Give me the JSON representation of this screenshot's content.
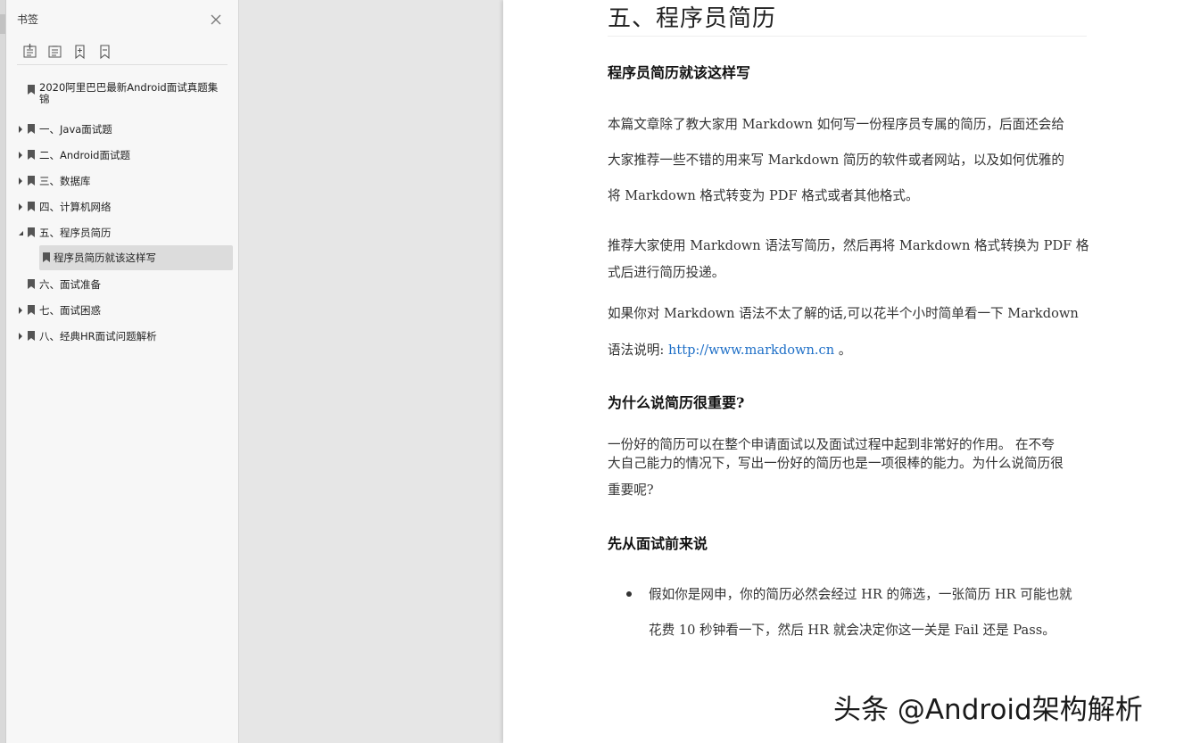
{
  "sidebar": {
    "title": "书签",
    "toolbar": [
      "expand-all",
      "collapse-all",
      "add-bookmark",
      "bookmark"
    ],
    "items": [
      {
        "label": "2020阿里巴巴最新Android面试真题集锦",
        "expandable": false
      },
      {
        "label": "一、Java面试题",
        "expandable": true
      },
      {
        "label": "二、Android面试题",
        "expandable": true
      },
      {
        "label": "三、数据库",
        "expandable": true
      },
      {
        "label": "四、计算机网络",
        "expandable": true
      },
      {
        "label": "五、程序员简历",
        "expandable": true,
        "expanded": true
      },
      {
        "label": "程序员简历就该这样写",
        "child": true,
        "selected": true
      },
      {
        "label": "六、面试准备",
        "expandable": false
      },
      {
        "label": "七、面试困惑",
        "expandable": true
      },
      {
        "label": "八、经典HR面试问题解析",
        "expandable": true
      }
    ]
  },
  "document": {
    "heading": "五、程序员简历",
    "section1_title": "程序员简历就该这样写",
    "para1_lines": [
      "本篇文章除了教大家用 Markdown 如何写一份程序员专属的简历，后面还会给",
      "大家推荐一些不错的用来写 Markdown 简历的软件或者网站，以及如何优雅的",
      "将 Markdown 格式转变为 PDF 格式或者其他格式。"
    ],
    "para2_lines": [
      "推荐大家使用 Markdown 语法写简历，然后再将 Markdown 格式转换为 PDF 格",
      "式后进行简历投递。"
    ],
    "para3_line1": "如果你对 Markdown 语法不太了解的话,可以花半个小时简单看一下 Markdown",
    "para3_prefix": "语法说明: ",
    "para3_link": "http://www.markdown.cn",
    "para3_suffix": " 。",
    "section2_title": "为什么说简历很重要?",
    "para4_lines": [
      "一份好的简历可以在整个申请面试以及面试过程中起到非常好的作用。 在不夸",
      "大自己能力的情况下，写出一份好的简历也是一项很棒的能力。为什么说简历很",
      "重要呢?"
    ],
    "section3_title": "先从面试前来说",
    "bullet_lines": [
      "假如你是网申，你的简历必然会经过 HR 的筛选，一张简历 HR 可能也就",
      "花费 10 秒钟看一下，然后 HR 就会决定你这一关是 Fail 还是 Pass。"
    ]
  },
  "watermark": "头条 @Android架构解析",
  "colors": {
    "sidebar_bg": "#f7f7f7",
    "selected_bg": "#dcdcdc",
    "link": "#1e6fc7",
    "canvas_bg": "#e6e6e6"
  }
}
